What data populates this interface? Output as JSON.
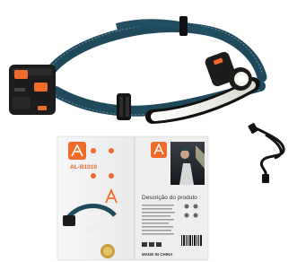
{
  "box": {
    "model": "AL-B1010",
    "panel_heading": "Descrição do produto",
    "made_in": "MADE IN CHINA"
  },
  "colors": {
    "strap": "#1f4a5c",
    "strap_edge": "#5d8796",
    "accent": "#f06a2a",
    "housing": "#1c1c1c",
    "led": "#f4f4ee"
  }
}
